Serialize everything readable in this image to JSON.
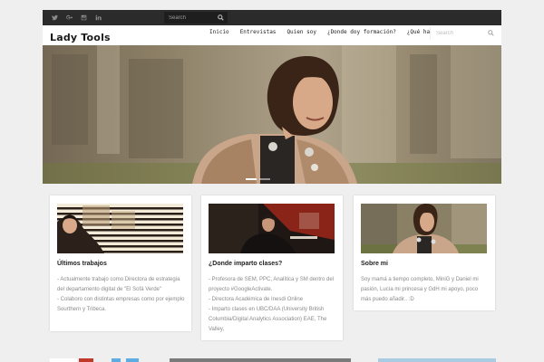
{
  "topbar": {
    "social": [
      "twitter-icon",
      "google-plus-icon",
      "instagram-icon",
      "linkedin-icon"
    ],
    "search_placeholder": "Search"
  },
  "header": {
    "logo": "Lady Tools",
    "search_placeholder": "Search"
  },
  "nav": {
    "items": [
      {
        "label": "Inicio"
      },
      {
        "label": "Entrevistas"
      },
      {
        "label": "Quien soy"
      },
      {
        "label": "¿Donde doy formación?"
      },
      {
        "label": "¿Qué hago?"
      }
    ]
  },
  "hero": {
    "slides": 2,
    "active": 0
  },
  "cards": [
    {
      "title": "Últimos trabajos",
      "lines": [
        "- Actualmente trabajo como Directora de estrategia del departamento digital de \"El Sofá Verde\"",
        "- Colaboro con distintas empresas como por ejemplo Sourthern y Tribeca."
      ]
    },
    {
      "title": "¿Donde imparto clases?",
      "lines": [
        "- Profesora de SEM, PPC, Analítica y SM dentro del proyecto #GoogleActivate.",
        "- Directora Académica de Inesdi Online",
        "- Imparto clases en UBC/DAA (University British Columbia/Digital Analytics Association) EAE, The Valley,"
      ]
    },
    {
      "title": "Sobre mi",
      "lines": [
        "Soy mamá a tiempo completo, MiniG y Daniel mi pasión, Lucía mi princesa y GdH mi apoyo, poco más puedo añadir.. :D"
      ]
    }
  ],
  "colors": {
    "topbar": "#2b2b2b",
    "background": "#efefef",
    "card": "#ffffff",
    "text_muted": "#8a8a8a"
  }
}
